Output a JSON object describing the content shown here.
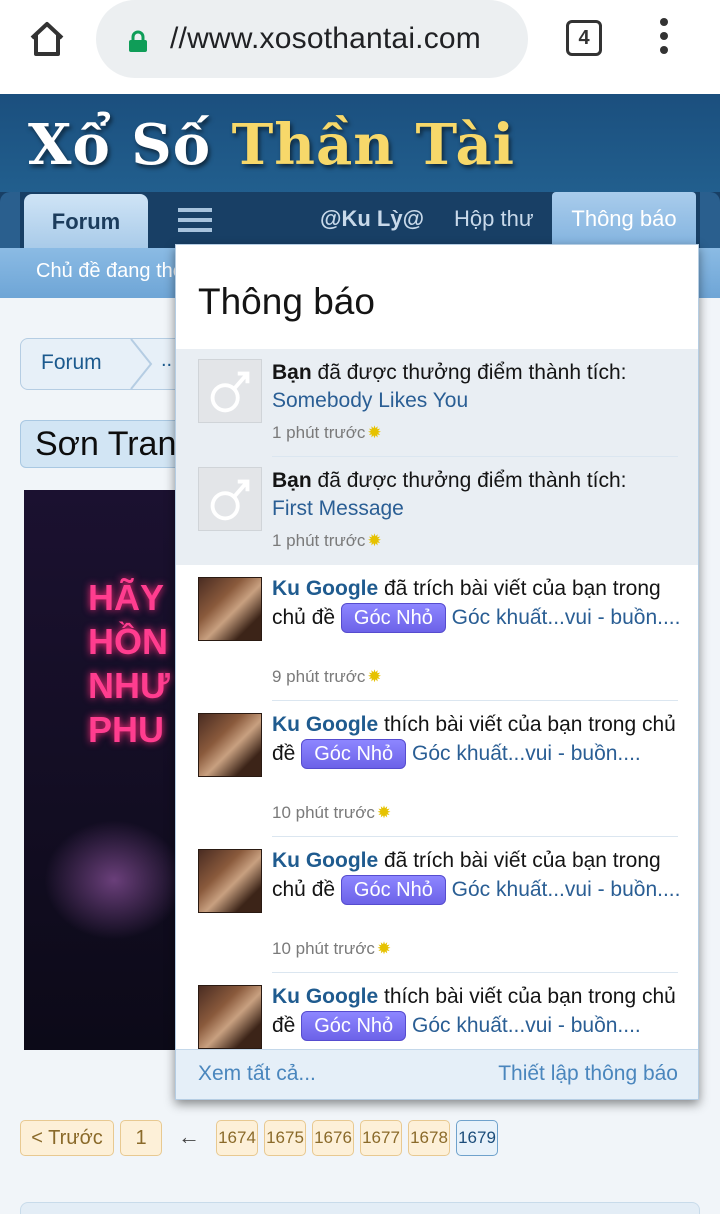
{
  "browser": {
    "url": "//www.xosothantai.com",
    "tab_count": "4"
  },
  "site": {
    "logo_white": "Xổ Số ",
    "logo_gold": "Thần Tài"
  },
  "nav": {
    "forum": "Forum",
    "user": "@Ku Lỳ@",
    "inbox": "Hộp thư",
    "notifications": "Thông báo"
  },
  "subnav": {
    "text": "Chủ đề đang theo dõi    Bài viết mới"
  },
  "page": {
    "breadcrumb_forum": "Forum",
    "breadcrumb_more": "..",
    "thread_title": "Sơn Trang",
    "banner_text": "HÃY\nHỒN\nNHƯ\nPHU"
  },
  "pagination": {
    "prev": "< Trước",
    "first": "1",
    "arrow": "←",
    "pages": [
      "1674",
      "1675",
      "1676",
      "1677",
      "1678",
      "1679"
    ],
    "current": "1679"
  },
  "popup": {
    "title": "Thông báo",
    "items": [
      {
        "subject": "Bạn",
        "text": " đã được thưởng điểm thành tích:",
        "link": "Somebody Likes You",
        "time": "1 phút trước",
        "avatar": "default-male-avatar"
      },
      {
        "subject": "Bạn",
        "text": " đã được thưởng điểm thành tích:",
        "link": "First Message",
        "time": "1 phút trước",
        "avatar": "default-male-avatar"
      },
      {
        "subject": "Ku Google",
        "text": " đã trích bài viết của bạn trong chủ đề ",
        "prefix": "Góc Nhỏ",
        "link": "Góc khuất...vui - buồn....",
        "time": "9 phút trước",
        "avatar": "user-photo-avatar"
      },
      {
        "subject": "Ku Google",
        "text": " thích bài viết của bạn trong chủ đề ",
        "prefix": "Góc Nhỏ",
        "link": "Góc khuất...vui - buồn....",
        "time": "10 phút trước",
        "avatar": "user-photo-avatar"
      },
      {
        "subject": "Ku Google",
        "text": " đã trích bài viết của bạn trong chủ đề ",
        "prefix": "Góc Nhỏ",
        "link": "Góc khuất...vui - buồn....",
        "time": "10 phút trước",
        "avatar": "user-photo-avatar"
      },
      {
        "subject": "Ku Google",
        "text": " thích bài viết của bạn trong chủ đề ",
        "prefix": "Góc Nhỏ",
        "link": "Góc khuất...vui - buồn....",
        "time": "",
        "avatar": "user-photo-avatar"
      }
    ],
    "footer_all": "Xem tất cả...",
    "footer_settings": "Thiết lập thông báo"
  },
  "colors": {
    "header_blue": "#1b4f7e",
    "logo_gold": "#f7d86a",
    "link_blue": "#2a5e94",
    "prefix_purple": "#7a72f2",
    "footer_link": "#4a86bd"
  }
}
